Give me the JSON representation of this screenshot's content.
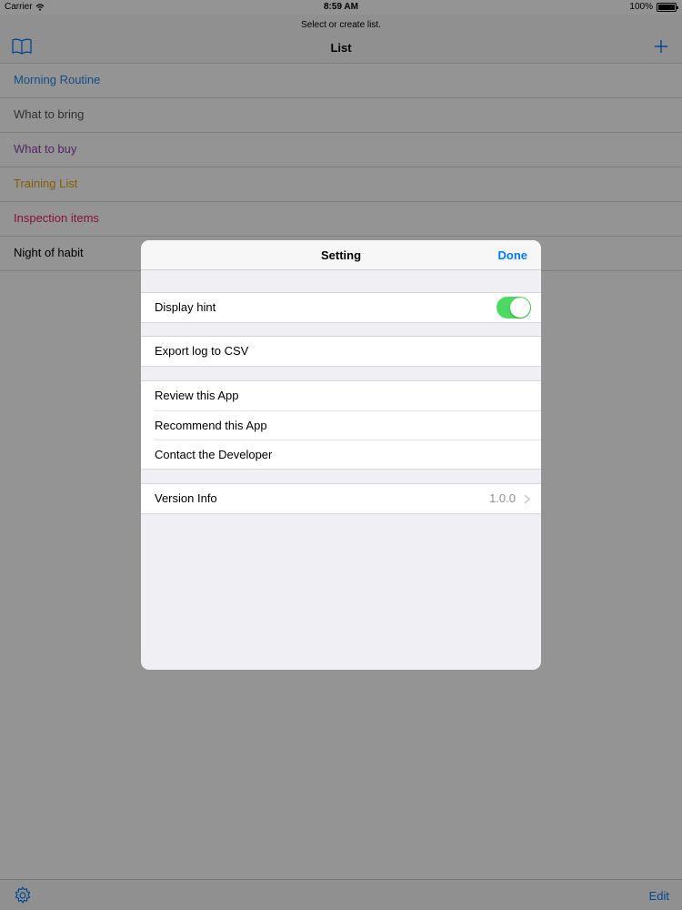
{
  "status_bar": {
    "carrier": "Carrier",
    "time": "8:59 AM",
    "battery": "100%"
  },
  "navbar": {
    "prompt": "Select or create list.",
    "title": "List"
  },
  "lists": [
    {
      "label": "Morning Routine",
      "color": "#1e88e5"
    },
    {
      "label": "What to bring",
      "color": "#555555"
    },
    {
      "label": "What to buy",
      "color": "#8e44ad"
    },
    {
      "label": "Training List",
      "color": "#e6a000"
    },
    {
      "label": "Inspection items",
      "color": "#e91e63"
    },
    {
      "label": "Night of habit",
      "color": "#000000"
    }
  ],
  "toolbar": {
    "edit_label": "Edit"
  },
  "modal": {
    "title": "Setting",
    "done_label": "Done",
    "display_hint": {
      "label": "Display hint",
      "enabled": true
    },
    "export_label": "Export log to CSV",
    "review_label": "Review this App",
    "recommend_label": "Recommend this App",
    "contact_label": "Contact the Developer",
    "version": {
      "label": "Version Info",
      "value": "1.0.0"
    }
  },
  "colors": {
    "accent": "#007aff",
    "switch_on": "#4cd964"
  }
}
